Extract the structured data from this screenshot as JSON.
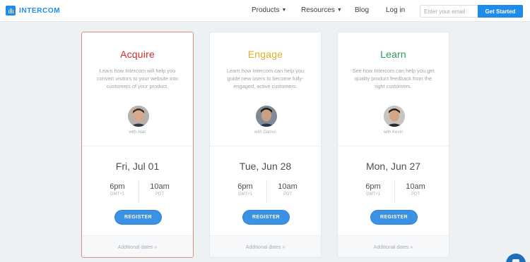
{
  "nav": {
    "brand": "INTERCOM",
    "links": [
      {
        "label": "Products",
        "has_caret": true
      },
      {
        "label": "Resources",
        "has_caret": true
      },
      {
        "label": "Blog",
        "has_caret": false
      },
      {
        "label": "Log in",
        "has_caret": false
      }
    ],
    "email_placeholder": "Enter your email",
    "cta_label": "Get Started",
    "caret_glyph": "▼"
  },
  "cards": [
    {
      "title": "Acquire",
      "title_color": "#d0292c",
      "description": "Learn how Intercom will help you convert visitors to your website into customers of your product.",
      "host": "with Alan",
      "date": "Fri, Jul 01",
      "time_local": "6pm",
      "tz_local": "GMT+1",
      "time_pdt": "10am",
      "tz_pdt": "PDT",
      "register_label": "REGISTER",
      "footer_link": "Additional dates »"
    },
    {
      "title": "Engage",
      "title_color": "#e1ad2a",
      "description": "Learn how Intercom can help you guide new users to become fully-engaged, active customers.",
      "host": "with Darren",
      "date": "Tue, Jun 28",
      "time_local": "6pm",
      "tz_local": "GMT+1",
      "time_pdt": "10am",
      "tz_pdt": "PDT",
      "register_label": "REGISTER",
      "footer_link": "Additional dates »"
    },
    {
      "title": "Learn",
      "title_color": "#2e9a53",
      "description": "See how Intercom can help you get quality product feedback from the right customers.",
      "host": "with Kevin",
      "date": "Mon, Jun 27",
      "time_local": "6pm",
      "tz_local": "GMT+1",
      "time_pdt": "10am",
      "tz_pdt": "PDT",
      "register_label": "REGISTER",
      "footer_link": "Additional dates »"
    }
  ]
}
